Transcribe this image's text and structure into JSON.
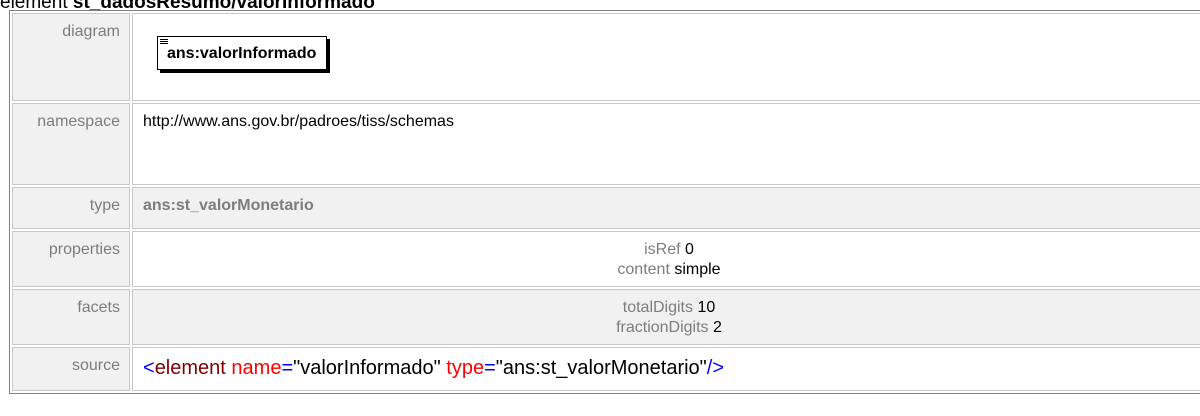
{
  "heading": {
    "prefix": "element",
    "name": "st_dadosResumo/valorInformado"
  },
  "rows": {
    "diagram": {
      "label": "diagram",
      "box_text": "ans:valorInformado"
    },
    "namespace": {
      "label": "namespace",
      "value": "http://www.ans.gov.br/padroes/tiss/schemas"
    },
    "type": {
      "label": "type",
      "value": "ans:st_valorMonetario"
    },
    "properties": {
      "label": "properties",
      "items": [
        {
          "key": "isRef",
          "value": "0"
        },
        {
          "key": "content",
          "value": "simple"
        }
      ]
    },
    "facets": {
      "label": "facets",
      "items": [
        {
          "key": "totalDigits",
          "value": "10"
        },
        {
          "key": "fractionDigits",
          "value": "2"
        }
      ]
    },
    "source": {
      "label": "source",
      "open_bracket": "<",
      "element": "element",
      "attr1": "name",
      "eq1": "=",
      "val1": "\"valorInformado\"",
      "attr2": "type",
      "eq2": "=",
      "val2": "\"ans:st_valorMonetario\"",
      "close": "/>"
    }
  },
  "colors": {
    "label_bg": "#f1f1f1",
    "label_text": "#7d7d7d",
    "tag": "#0000ff",
    "attr": "#ff0000",
    "element": "#800000"
  }
}
